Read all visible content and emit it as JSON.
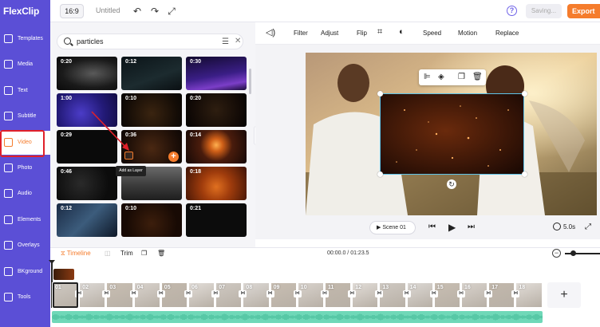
{
  "topbar": {
    "logo": "FlexClip",
    "ratio": "16:9",
    "doc_title": "Untitled",
    "help_icon": "?",
    "saving_label": "Saving...",
    "export_label": "Export"
  },
  "sidebar": {
    "items": [
      {
        "label": "Templates"
      },
      {
        "label": "Media"
      },
      {
        "label": "Text"
      },
      {
        "label": "Subtitle"
      },
      {
        "label": "Video",
        "active": true
      },
      {
        "label": "Photo"
      },
      {
        "label": "Audio"
      },
      {
        "label": "Elements"
      },
      {
        "label": "Overlays"
      },
      {
        "label": "BKground"
      },
      {
        "label": "Tools"
      }
    ]
  },
  "search": {
    "value": "particles"
  },
  "thumbnails": [
    {
      "duration": "0:20"
    },
    {
      "duration": "0:12"
    },
    {
      "duration": "0:30"
    },
    {
      "duration": "1:00"
    },
    {
      "duration": "0:10"
    },
    {
      "duration": "0:20"
    },
    {
      "duration": "0:29"
    },
    {
      "duration": "0:36"
    },
    {
      "duration": "0:14"
    },
    {
      "duration": "0:46"
    },
    {
      "duration": ""
    },
    {
      "duration": "0:18"
    },
    {
      "duration": "0:12"
    },
    {
      "duration": "0:10"
    },
    {
      "duration": "0:21"
    }
  ],
  "tooltip": "Add as Layer",
  "toolbar": {
    "filter": "Filter",
    "adjust": "Adjust",
    "flip": "Flip",
    "speed": "Speed",
    "motion": "Motion",
    "replace": "Replace"
  },
  "playback": {
    "scene_label": "Scene",
    "scene_number": "01",
    "duration": "5.0s"
  },
  "timeline": {
    "tab_timeline": "Timeline",
    "tab_trim": "Trim",
    "time_display": "00:00.0 / 01:23.5",
    "clip_labels": [
      "01",
      "02",
      "03",
      "04",
      "05",
      "06",
      "07",
      "08",
      "09",
      "10",
      "11",
      "12",
      "13",
      "14",
      "15",
      "16",
      "17",
      "18"
    ]
  },
  "colors": {
    "brand": "#5b4fd6",
    "accent": "#f57c2c",
    "audio": "#6fd8b8",
    "selection": "#5ec3e8",
    "highlight": "#e0202a"
  }
}
